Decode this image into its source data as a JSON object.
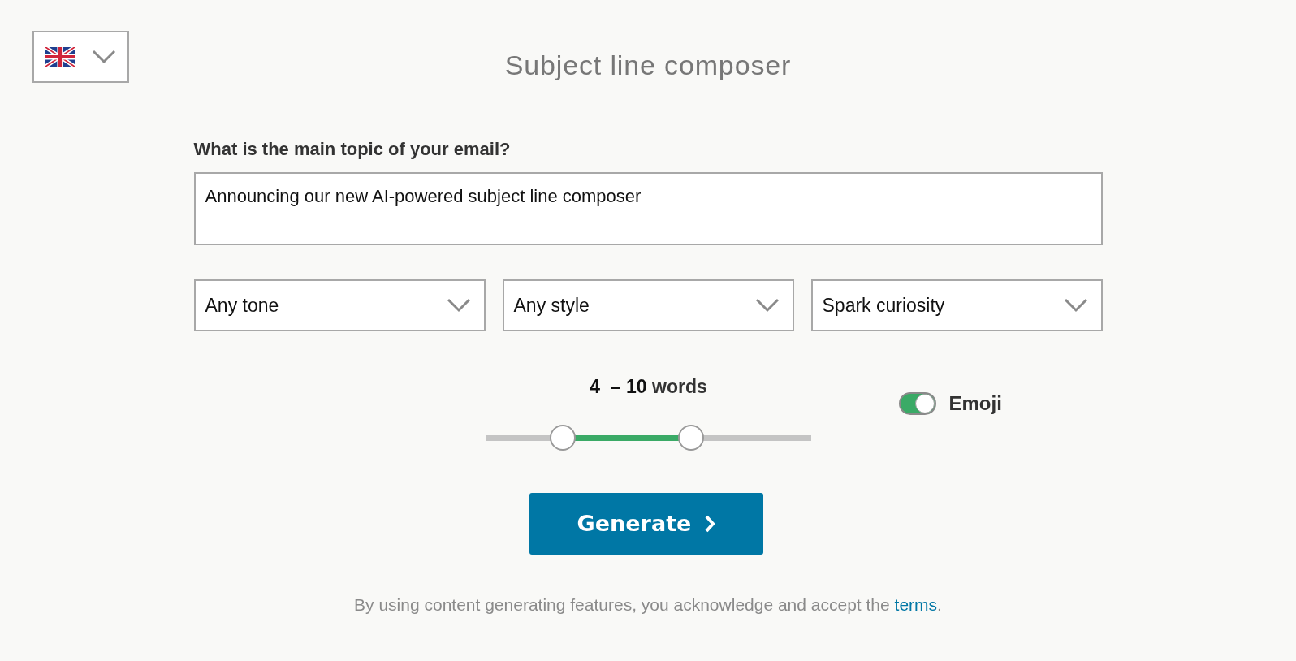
{
  "language_select": {
    "expanded": false
  },
  "title": "Subject line composer",
  "topic": {
    "label": "What is the main topic of your email?",
    "value": "Announcing our new AI-powered subject line composer"
  },
  "dropdowns": [
    {
      "value": "Any tone"
    },
    {
      "value": "Any style"
    },
    {
      "value": "Spark curiosity"
    }
  ],
  "word_range": {
    "min": "4",
    "separator": "–",
    "max": "10",
    "unit": "words",
    "handles": [
      {
        "level": 0.235
      },
      {
        "level": 0.63
      }
    ]
  },
  "emoji_toggle": {
    "label": "Emoji",
    "on": true
  },
  "generate_button": {
    "label": "Generate"
  },
  "footer": {
    "text": "By using content generating features, you acknowledge and accept the",
    "link": "terms",
    "end": "."
  }
}
